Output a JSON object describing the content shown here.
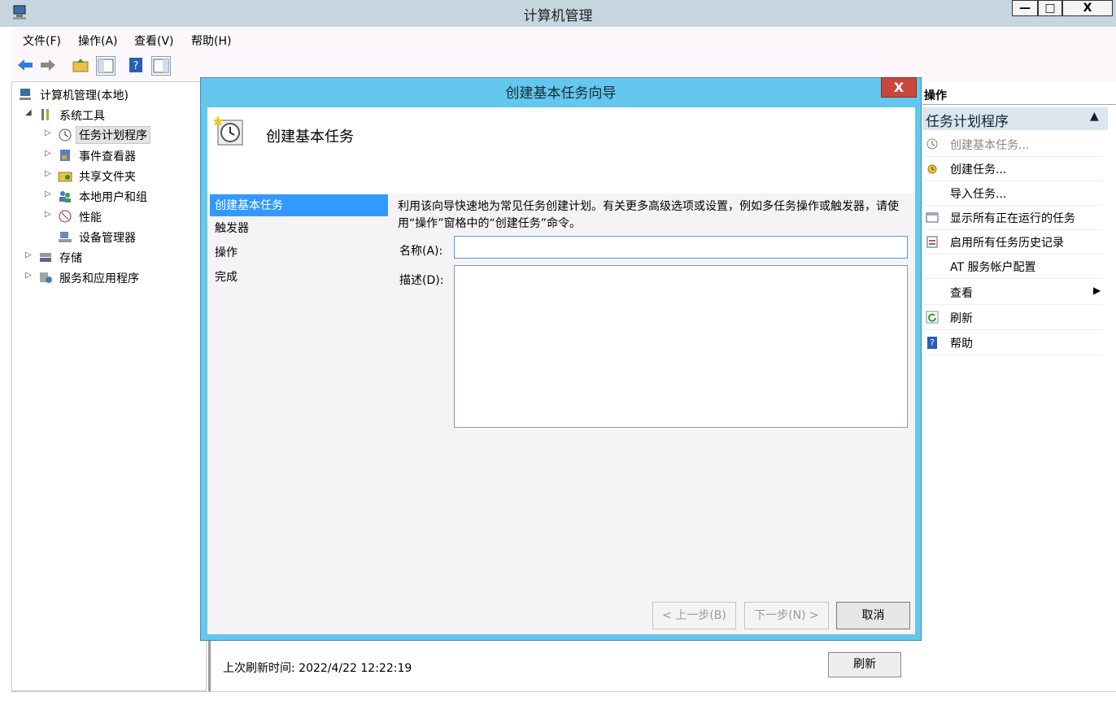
{
  "window": {
    "title": "计算机管理",
    "minimize": "—",
    "maximize": "□",
    "close": "X"
  },
  "menu": [
    "文件(F)",
    "操作(A)",
    "查看(V)",
    "帮助(H)"
  ],
  "tree": {
    "root": "计算机管理(本地)",
    "system_tools": "系统工具",
    "task_scheduler": "任务计划程序",
    "event_viewer": "事件查看器",
    "shared_folders": "共享文件夹",
    "local_users": "本地用户和组",
    "performance": "性能",
    "device_manager": "设备管理器",
    "storage": "存储",
    "services_apps": "服务和应用程序"
  },
  "actions": {
    "header": "操作",
    "group": "任务计划程序",
    "items": [
      {
        "label": "创建基本任务...",
        "icon": "task-clock-icon",
        "disabled": true
      },
      {
        "label": "创建任务...",
        "icon": "create-task-icon"
      },
      {
        "label": "导入任务...",
        "icon": ""
      },
      {
        "label": "显示所有正在运行的任务",
        "icon": "running-tasks-icon"
      },
      {
        "label": "启用所有任务历史记录",
        "icon": "history-icon"
      },
      {
        "label": "AT 服务帐户配置",
        "icon": ""
      },
      {
        "label": "查看",
        "icon": ""
      },
      {
        "label": "刷新",
        "icon": "refresh-icon"
      },
      {
        "label": "帮助",
        "icon": "help-icon"
      }
    ]
  },
  "behind": {
    "refresh_time": "上次刷新时间: 2022/4/22 12:22:19",
    "refresh_button": "刷新"
  },
  "dialog": {
    "title": "创建基本任务向导",
    "close": "X",
    "heading": "创建基本任务",
    "steps": [
      "创建基本任务",
      "触发器",
      "操作",
      "完成"
    ],
    "intro": "利用该向导快速地为常见任务创建计划。有关更多高级选项或设置，例如多任务操作或触发器，请使用“操作”窗格中的“创建任务”命令。",
    "name_label": "名称(A):",
    "name_value": "",
    "desc_label": "描述(D):",
    "desc_value": "",
    "back": "< 上一步(B)",
    "next": "下一步(N) >",
    "cancel": "取消"
  }
}
